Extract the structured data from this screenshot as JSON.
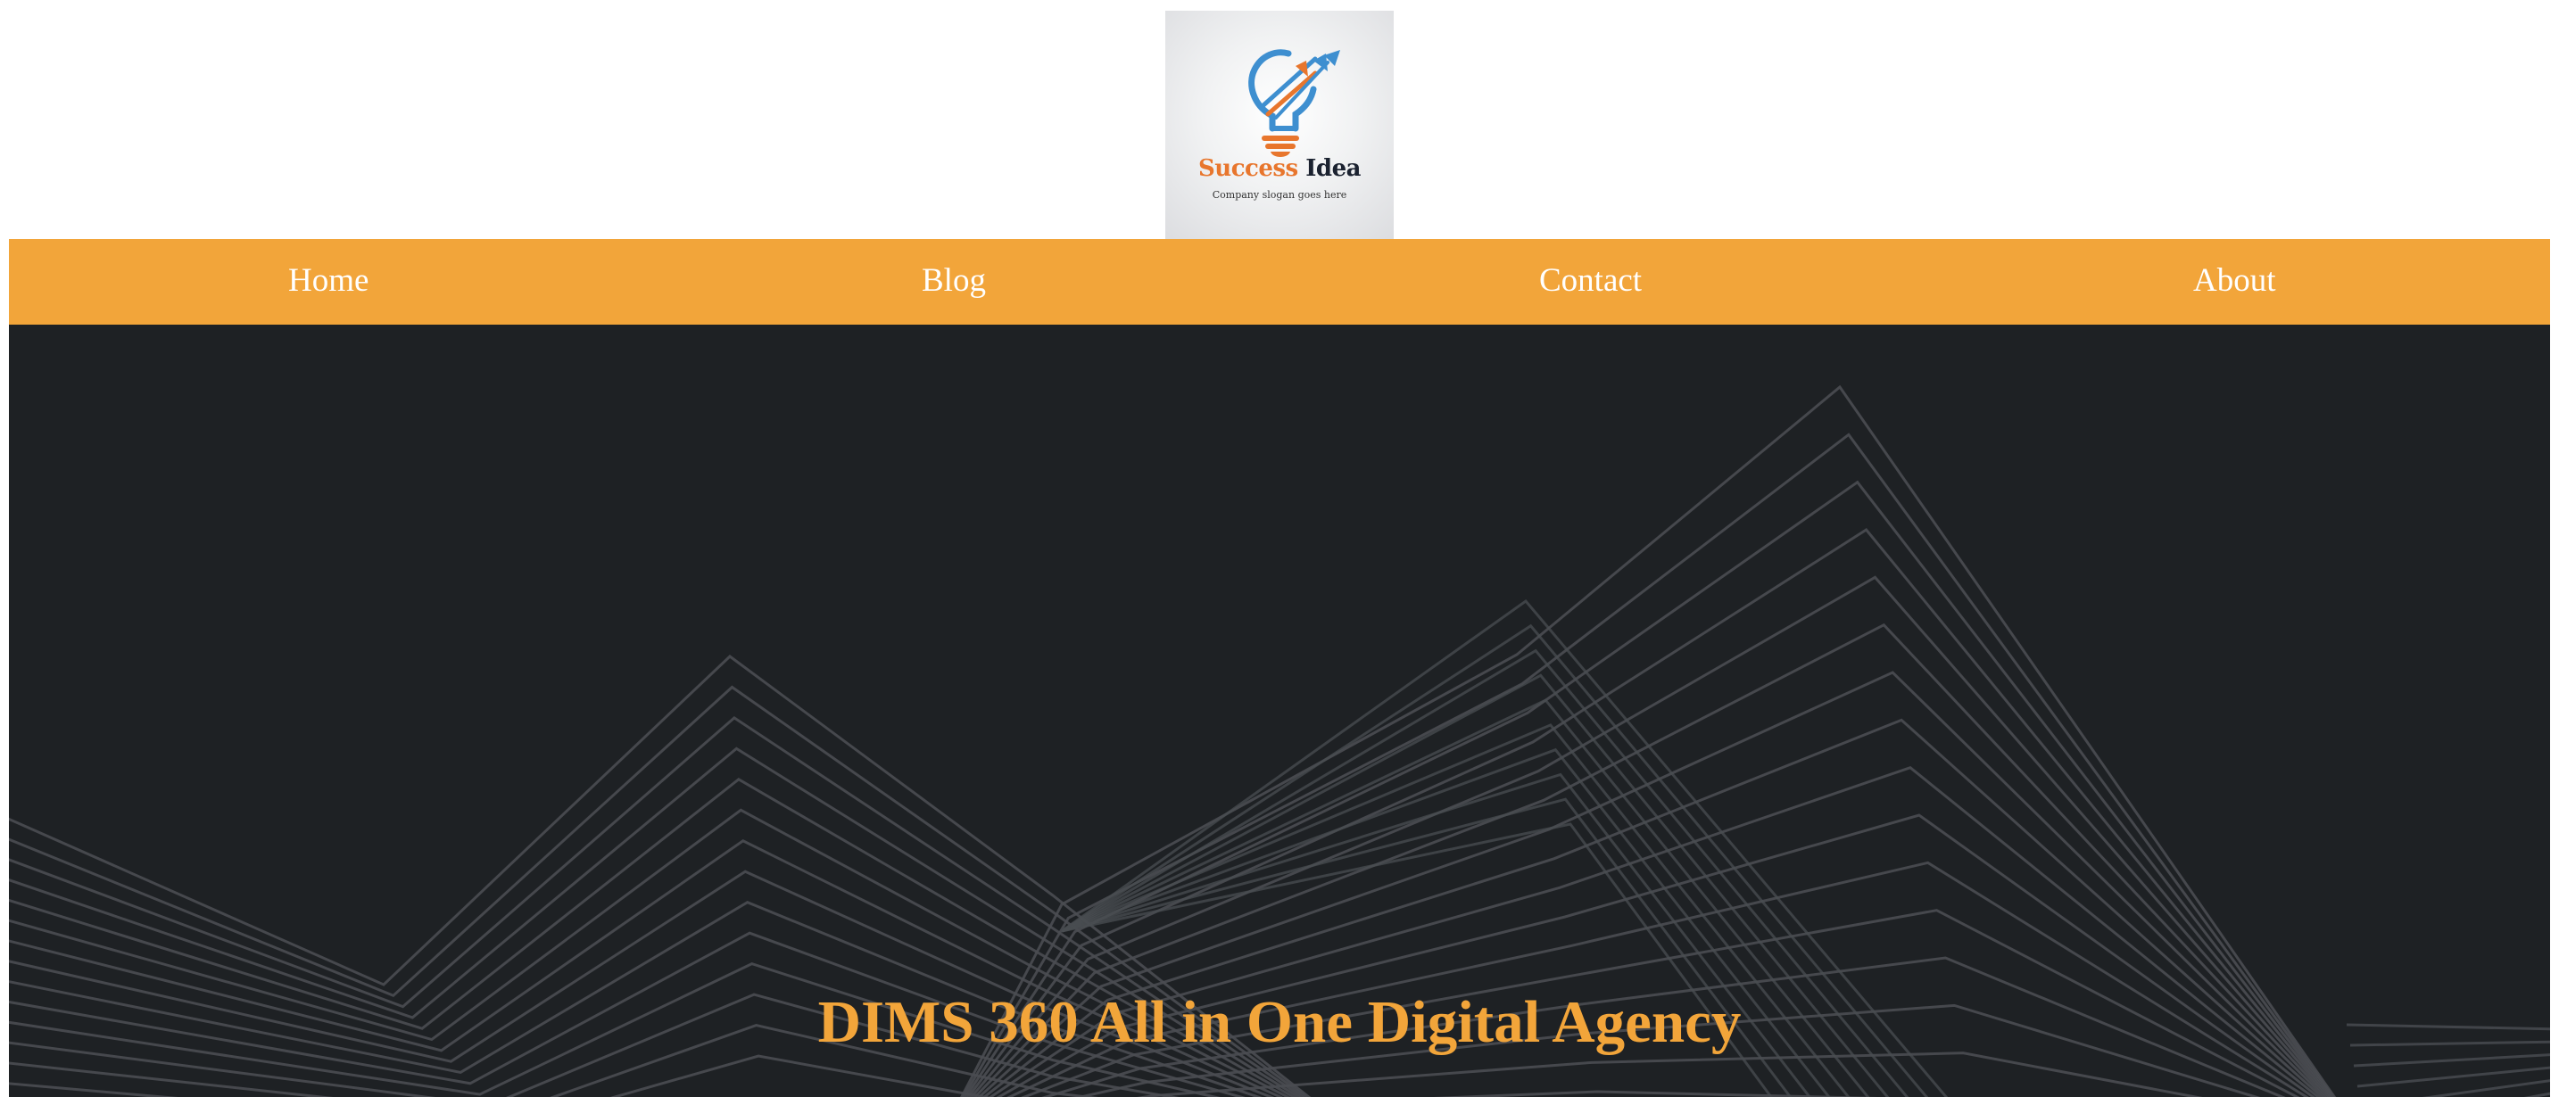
{
  "logo": {
    "brand_word_1": "Success",
    "brand_word_2": "Idea",
    "slogan": "Company slogan goes here",
    "icon": "lightbulb-growth-arrows-icon",
    "colors": {
      "orange": "#e8762d",
      "blue": "#3e8fd0",
      "dark": "#1b2230"
    }
  },
  "nav": {
    "items": [
      {
        "label": "Home"
      },
      {
        "label": "Blog"
      },
      {
        "label": "Contact"
      },
      {
        "label": "About"
      }
    ]
  },
  "hero": {
    "title": "DIMS 360 All in One Digital Agency",
    "background_pattern": "geometric-mountain-lines"
  },
  "colors": {
    "accent": "#f2a53a",
    "hero_background": "#1e2124",
    "nav_text": "#ffffff",
    "pattern_lines": "#4a4d52"
  }
}
